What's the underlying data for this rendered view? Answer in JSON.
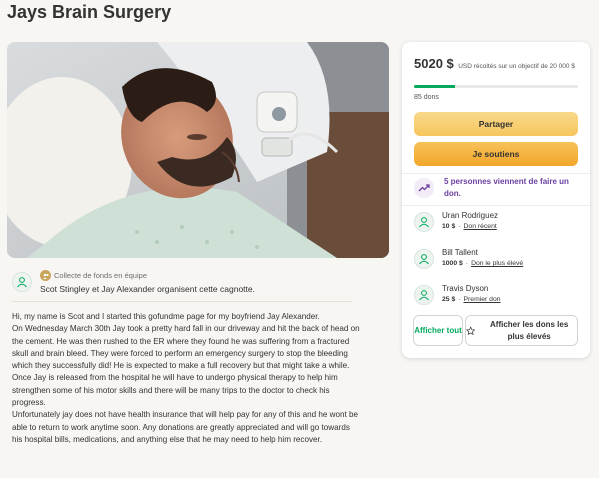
{
  "page": {
    "title": "Jays Brain Surgery"
  },
  "hero": {
    "image_alt": "Jay lying in a hospital bed"
  },
  "organizer": {
    "team_label": "Collecte de fonds en équipe",
    "organizers_text": "Scot Stingley et Jay Alexander organisent cette cagnotte."
  },
  "story": {
    "paragraphs": [
      "Hi, my name is Scot and I started this gofundme page for my boyfriend Jay Alexander.",
      "On Wednesday March 30th Jay took a pretty hard fall in our driveway and hit the back of head on the cement. He was then rushed to the ER where they found he was suffering from a fractured skull and brain bleed. They were forced to perform an emergency surgery to stop the bleeding which they successfully did! He is expected to make a full recovery but that might take a while.",
      "Once Jay is released from the hospital he will have to undergo physical therapy to help him strengthen some of his motor skills and there will be many trips to the doctor to check his progress.",
      "Unfortunately jay does not have health insurance that will help pay for any of this and he wont be able to return to work anytime soon. Any donations are greatly appreciated and will go towards his hospital bills, medications, and anything else that he may need to help him recover."
    ]
  },
  "donation": {
    "raised": "5020 $",
    "goal_text": "USD récoltés sur un objectif de 20 000 $",
    "progress_fraction": 0.251,
    "donor_count": "85 dons",
    "share_label": "Partager",
    "donate_label": "Je soutiens",
    "trending_text": "5 personnes viennent de faire un don.",
    "donors": [
      {
        "name": "Uran Rodriguez",
        "amount": "10 $",
        "tag": "Don récent"
      },
      {
        "name": "Bill Tallent",
        "amount": "1000 $",
        "tag": "Don le plus élevé"
      },
      {
        "name": "Travis Dyson",
        "amount": "25 $",
        "tag": "Premier don"
      }
    ],
    "see_all_label": "Afficher tout",
    "see_top_label": "Afficher les dons les plus élevés"
  },
  "colors": {
    "accent_green": "#02a95c",
    "button_yellow": "#f6c65d",
    "button_orange": "#f2a629",
    "trending_purple": "#6b3fa0"
  },
  "icons": {
    "organizer": "person-icon",
    "team": "team-icon",
    "trending": "trend-up-icon",
    "donor": "person-icon",
    "top_donations": "star-icon"
  }
}
